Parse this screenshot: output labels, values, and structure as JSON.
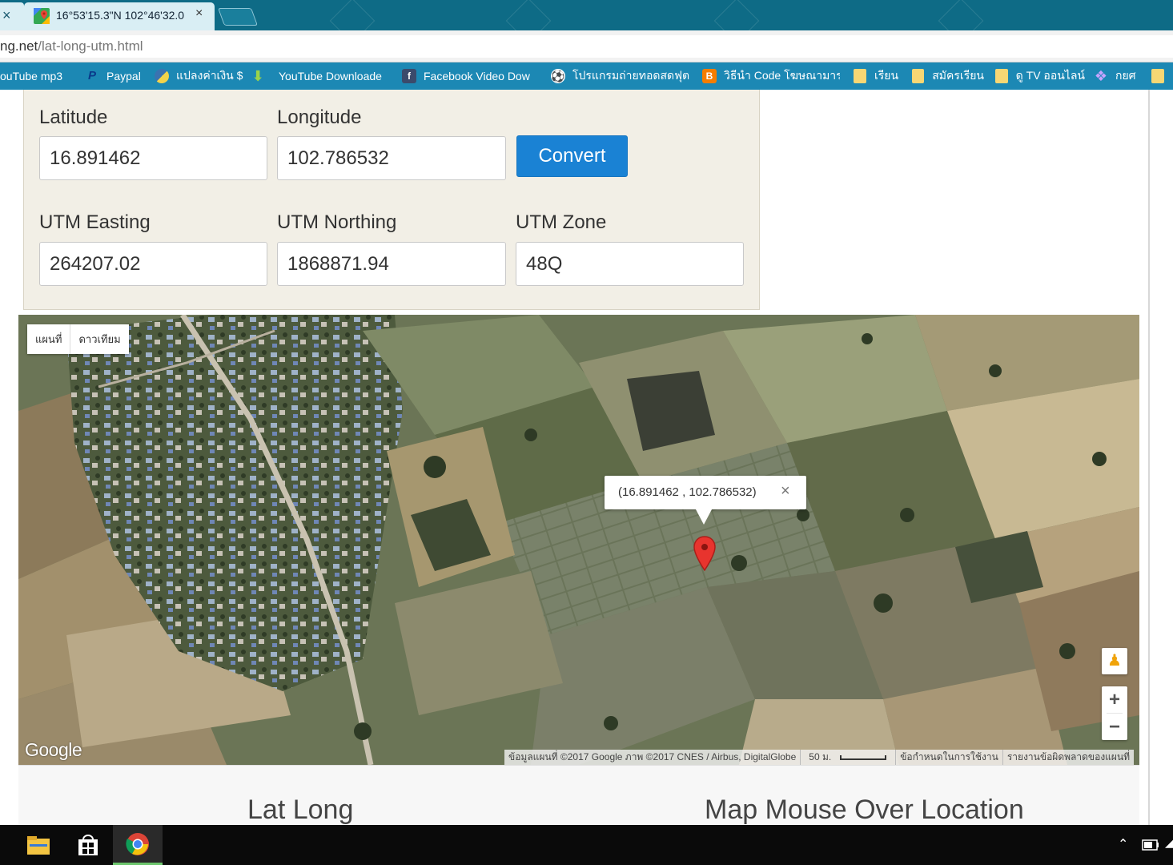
{
  "browser": {
    "prev_tab_close": "×",
    "active_tab_title": "16°53'15.3\"N 102°46'32.0",
    "active_tab_close": "×",
    "url_host_partial": "ng.net",
    "url_path": "/lat-long-utm.html"
  },
  "bookmarks": [
    {
      "label": "ouTube mp3",
      "icon": "none"
    },
    {
      "label": "Paypal",
      "icon": "paypal-icon"
    },
    {
      "label": "แปลงค่าเงิน $",
      "icon": "python-icon"
    },
    {
      "label": "YouTube Downloade",
      "icon": "download-arrow-icon"
    },
    {
      "label": "Facebook Video Dow",
      "icon": "facebook-icon"
    },
    {
      "label": "โปรแกรมถ่ายทอดสดฟุต",
      "icon": "soccer-ball-icon"
    },
    {
      "label": "วิธีนำ Code โฆษณามาร",
      "icon": "blogger-icon"
    },
    {
      "label": "เรียน",
      "icon": "folder-icon"
    },
    {
      "label": "สมัครเรียน",
      "icon": "folder-icon"
    },
    {
      "label": "ดู TV ออนไลน์",
      "icon": "folder-icon"
    },
    {
      "label": "กยศ",
      "icon": "diamond-icon"
    }
  ],
  "form": {
    "latitude_label": "Latitude",
    "latitude_value": "16.891462",
    "longitude_label": "Longitude",
    "longitude_value": "102.786532",
    "convert_label": "Convert",
    "easting_label": "UTM Easting",
    "easting_value": "264207.02",
    "northing_label": "UTM Northing",
    "northing_value": "1868871.94",
    "zone_label": "UTM Zone",
    "zone_value": "48Q"
  },
  "map": {
    "type_map": "แผนที่",
    "type_satellite": "ดาวเทียม",
    "infowindow_text": "(16.891462 , 102.786532)",
    "infowindow_close": "×",
    "logo": "Google",
    "attribution": "ข้อมูลแผนที่ ©2017 Google ภาพ ©2017 CNES / Airbus, DigitalGlobe",
    "scale": "50 ม.",
    "terms": "ข้อกำหนดในการใช้งาน",
    "report": "รายงานข้อผิดพลาดของแผนที่",
    "zoom_in": "+",
    "zoom_out": "−"
  },
  "bottom": {
    "left_heading": "Lat Long",
    "right_heading": "Map Mouse Over Location"
  },
  "colors": {
    "tab_bar": "#0e6b86",
    "bookmark_bar": "#1c88b4",
    "convert_button": "#1a82d4",
    "form_panel": "#f2efe6",
    "marker": "#e8342e"
  }
}
